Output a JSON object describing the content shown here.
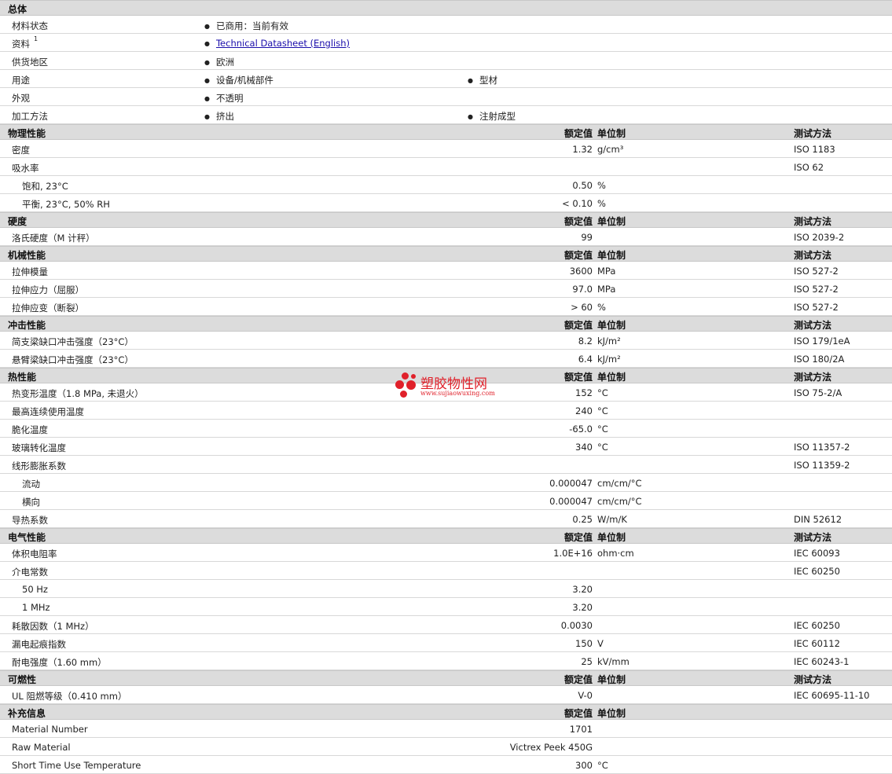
{
  "general": {
    "title": "总体",
    "rows": [
      {
        "label": "材料状态",
        "v1": "已商用：当前有效",
        "v2": ""
      },
      {
        "label": "资料",
        "sup": "1",
        "link": "Technical Datasheet (English)",
        "v2": ""
      },
      {
        "label": "供货地区",
        "v1": "欧洲",
        "v2": ""
      },
      {
        "label": "用途",
        "v1": "设备/机械部件",
        "v2": "型材"
      },
      {
        "label": "外观",
        "v1": "不透明",
        "v2": ""
      },
      {
        "label": "加工方法",
        "v1": "挤出",
        "v2": "注射成型"
      }
    ]
  },
  "headers": {
    "value": "额定值",
    "unit": "单位制",
    "method": "测试方法"
  },
  "sections": [
    {
      "title": "物理性能",
      "rows": [
        {
          "label": "密度",
          "value": "1.32",
          "unit": "g/cm³",
          "method": "ISO 1183"
        },
        {
          "label": "吸水率",
          "value": "",
          "unit": "",
          "method": "ISO 62"
        },
        {
          "label": "饱和, 23°C",
          "sub": true,
          "value": "0.50",
          "unit": "%",
          "method": ""
        },
        {
          "label": "平衡, 23°C, 50% RH",
          "sub": true,
          "value": "< 0.10",
          "unit": "%",
          "method": ""
        }
      ]
    },
    {
      "title": "硬度",
      "rows": [
        {
          "label": "洛氏硬度（M 计秤）",
          "value": "99",
          "unit": "",
          "method": "ISO 2039-2"
        }
      ]
    },
    {
      "title": "机械性能",
      "rows": [
        {
          "label": "拉伸模量",
          "value": "3600",
          "unit": "MPa",
          "method": "ISO 527-2"
        },
        {
          "label": "拉伸应力（屈服）",
          "value": "97.0",
          "unit": "MPa",
          "method": "ISO 527-2"
        },
        {
          "label": "拉伸应变（断裂）",
          "value": "> 60",
          "unit": "%",
          "method": "ISO 527-2"
        }
      ]
    },
    {
      "title": "冲击性能",
      "rows": [
        {
          "label": "简支梁缺口冲击强度（23°C）",
          "value": "8.2",
          "unit": "kJ/m²",
          "method": "ISO 179/1eA"
        },
        {
          "label": "悬臂梁缺口冲击强度（23°C）",
          "value": "6.4",
          "unit": "kJ/m²",
          "method": "ISO 180/2A"
        }
      ]
    },
    {
      "title": "热性能",
      "rows": [
        {
          "label": "热变形温度（1.8 MPa, 未退火）",
          "value": "152",
          "unit": "°C",
          "method": "ISO 75-2/A"
        },
        {
          "label": "最高连续使用温度",
          "value": "240",
          "unit": "°C",
          "method": ""
        },
        {
          "label": "脆化温度",
          "value": "-65.0",
          "unit": "°C",
          "method": ""
        },
        {
          "label": "玻璃转化温度",
          "value": "340",
          "unit": "°C",
          "method": "ISO 11357-2"
        },
        {
          "label": "线形膨胀系数",
          "value": "",
          "unit": "",
          "method": "ISO 11359-2"
        },
        {
          "label": "流动",
          "sub": true,
          "value": "0.000047",
          "unit": "cm/cm/°C",
          "method": ""
        },
        {
          "label": "横向",
          "sub": true,
          "value": "0.000047",
          "unit": "cm/cm/°C",
          "method": ""
        },
        {
          "label": "导热系数",
          "value": "0.25",
          "unit": "W/m/K",
          "method": "DIN 52612"
        }
      ]
    },
    {
      "title": "电气性能",
      "rows": [
        {
          "label": "体积电阻率",
          "value": "1.0E+16",
          "unit": "ohm·cm",
          "method": "IEC 60093"
        },
        {
          "label": "介电常数",
          "value": "",
          "unit": "",
          "method": "IEC 60250"
        },
        {
          "label": "50 Hz",
          "sub": true,
          "value": "3.20",
          "unit": "",
          "method": ""
        },
        {
          "label": "1 MHz",
          "sub": true,
          "value": "3.20",
          "unit": "",
          "method": ""
        },
        {
          "label": "耗散因数（1 MHz）",
          "value": "0.0030",
          "unit": "",
          "method": "IEC 60250"
        },
        {
          "label": "漏电起痕指数",
          "value": "150",
          "unit": "V",
          "method": "IEC 60112"
        },
        {
          "label": "耐电强度（1.60 mm）",
          "value": "25",
          "unit": "kV/mm",
          "method": "IEC 60243-1"
        }
      ]
    },
    {
      "title": "可燃性",
      "rows": [
        {
          "label": "UL 阻燃等级（0.410 mm）",
          "value": "V-0",
          "unit": "",
          "method": "IEC 60695-11-10"
        }
      ]
    },
    {
      "title": "补充信息",
      "no_method": true,
      "rows": [
        {
          "label": "Material Number",
          "value": "1701",
          "unit": "",
          "method": ""
        },
        {
          "label": "Raw Material",
          "value": "Victrex Peek 450G",
          "unit": "",
          "method": ""
        },
        {
          "label": "Short Time Use Temperature",
          "value": "300",
          "unit": "°C",
          "method": ""
        }
      ]
    }
  ],
  "watermark": {
    "cn": "塑胶物性网",
    "en": "www.sujiaowuxing.com",
    "color": "#e0202a"
  }
}
